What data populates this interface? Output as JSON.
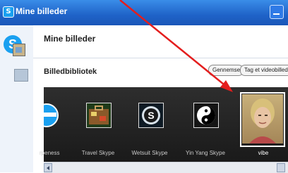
{
  "window": {
    "title": "Mine billeder"
  },
  "page": {
    "title": "Mine billeder"
  },
  "library": {
    "title": "Billedbibliotek",
    "browse_label": "Gennemse...",
    "take_label": "Tag et videobillede"
  },
  "gallery": {
    "items": [
      {
        "caption": "rpeness",
        "icon": "round-blue-emblem"
      },
      {
        "caption": "Travel Skype",
        "icon": "suitcase"
      },
      {
        "caption": "Wetsuit Skype",
        "icon": "skype-logo-dark"
      },
      {
        "caption": "Yin Yang Skype",
        "icon": "yin-yang"
      },
      {
        "caption": "vibe",
        "icon": "portrait-photo",
        "selected": true
      }
    ]
  },
  "colors": {
    "titlebar": "#1f63c8",
    "annotation_arrow": "#e41e1e",
    "gallery_bg": "#222222"
  }
}
